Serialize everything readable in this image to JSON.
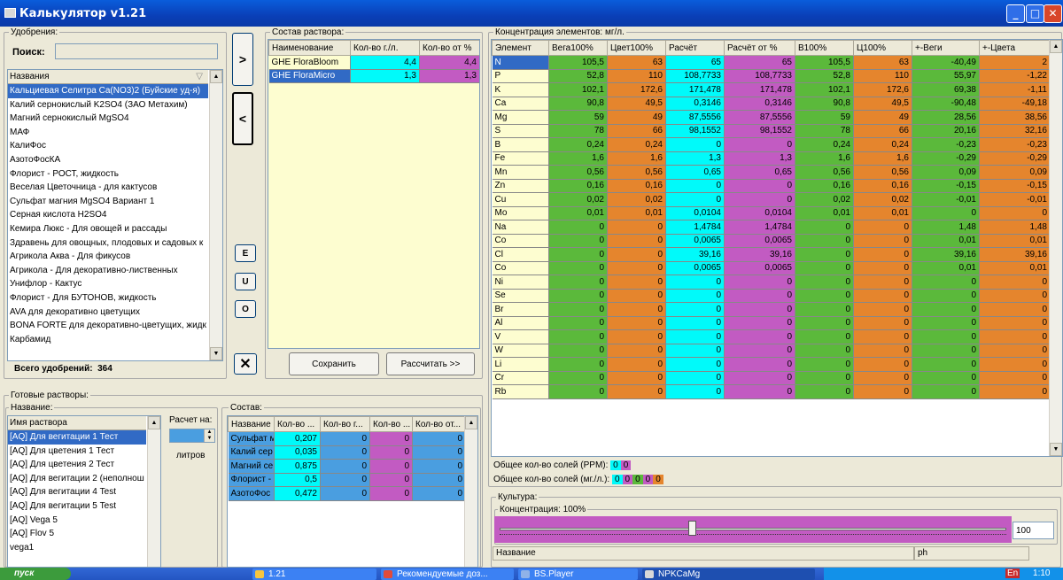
{
  "window": {
    "title": "Калькулятор v1.21",
    "btn_min": "_",
    "btn_max": "□",
    "btn_close": "✕"
  },
  "fert": {
    "group_title": "Удобрения:",
    "search_label": "Поиск:",
    "search_value": "",
    "col_header": "Названия",
    "total_label": "Всего удобрений:",
    "total_value": "364",
    "items": [
      "Кальциевая Селитра Ca(NO3)2 (Буйские уд-я)",
      "Калий  сернокислый  K2SO4 (ЗАО Метахим)",
      "Магний сернокислый MgSO4",
      "МАФ",
      "КалиФос",
      "АзотоФосКА",
      "Флорист - РОСТ, жидкость",
      "Веселая Цветочница - для кактусов",
      "Сульфат магния MgSO4 Вариант 1",
      "Серная кислота H2SO4",
      "Кемира Люкс - Для овощей и рассады",
      "Здравень для овощных, плодовых и садовых к",
      "Агрикола Аква - Для фикусов",
      "Агрикола - Для декоративно-лиственных",
      "Унифлор - Кактус",
      "Флорист - Для БУТОНОВ, жидкость",
      "AVA для декоративно цветущих",
      "BONA FORTE для декоративно-цветущих, жидк",
      "Карбамид"
    ]
  },
  "mid_buttons": {
    "add": ">",
    "remove": "<",
    "e": "E",
    "u": "U",
    "o": "O",
    "clear": "✕"
  },
  "sostav": {
    "group_title": "Состав раствора:",
    "headers": [
      "Наименование",
      "Кол-во г./л.",
      "Кол-во от %"
    ],
    "rows": [
      {
        "name": "GHE FloraBloom",
        "g": "4,4",
        "p": "4,4"
      },
      {
        "name": "GHE FloraMicro",
        "g": "1,3",
        "p": "1,3"
      }
    ],
    "save": "Сохранить",
    "calc": "Рассчитать >>"
  },
  "conc": {
    "group_title": "Концентрация элементов: мг/л.",
    "headers": [
      "Элемент",
      "Вега100%",
      "Цвет100%",
      "Расчёт",
      "Расчёт от %",
      "В100%",
      "Ц100%",
      "+-Веги",
      "+-Цвета"
    ],
    "rows": [
      [
        "N",
        "105,5",
        "63",
        "65",
        "65",
        "105,5",
        "63",
        "-40,49",
        "2"
      ],
      [
        "P",
        "52,8",
        "110",
        "108,7733",
        "108,7733",
        "52,8",
        "110",
        "55,97",
        "-1,22"
      ],
      [
        "K",
        "102,1",
        "172,6",
        "171,478",
        "171,478",
        "102,1",
        "172,6",
        "69,38",
        "-1,11"
      ],
      [
        "Ca",
        "90,8",
        "49,5",
        "0,3146",
        "0,3146",
        "90,8",
        "49,5",
        "-90,48",
        "-49,18"
      ],
      [
        "Mg",
        "59",
        "49",
        "87,5556",
        "87,5556",
        "59",
        "49",
        "28,56",
        "38,56"
      ],
      [
        "S",
        "78",
        "66",
        "98,1552",
        "98,1552",
        "78",
        "66",
        "20,16",
        "32,16"
      ],
      [
        "B",
        "0,24",
        "0,24",
        "0",
        "0",
        "0,24",
        "0,24",
        "-0,23",
        "-0,23"
      ],
      [
        "Fe",
        "1,6",
        "1,6",
        "1,3",
        "1,3",
        "1,6",
        "1,6",
        "-0,29",
        "-0,29"
      ],
      [
        "Mn",
        "0,56",
        "0,56",
        "0,65",
        "0,65",
        "0,56",
        "0,56",
        "0,09",
        "0,09"
      ],
      [
        "Zn",
        "0,16",
        "0,16",
        "0",
        "0",
        "0,16",
        "0,16",
        "-0,15",
        "-0,15"
      ],
      [
        "Cu",
        "0,02",
        "0,02",
        "0",
        "0",
        "0,02",
        "0,02",
        "-0,01",
        "-0,01"
      ],
      [
        "Mo",
        "0,01",
        "0,01",
        "0,0104",
        "0,0104",
        "0,01",
        "0,01",
        "0",
        "0"
      ],
      [
        "Na",
        "0",
        "0",
        "1,4784",
        "1,4784",
        "0",
        "0",
        "1,48",
        "1,48"
      ],
      [
        "Co",
        "0",
        "0",
        "0,0065",
        "0,0065",
        "0",
        "0",
        "0,01",
        "0,01"
      ],
      [
        "Cl",
        "0",
        "0",
        "39,16",
        "39,16",
        "0",
        "0",
        "39,16",
        "39,16"
      ],
      [
        "Co",
        "0",
        "0",
        "0,0065",
        "0,0065",
        "0",
        "0",
        "0,01",
        "0,01"
      ],
      [
        "Ni",
        "0",
        "0",
        "0",
        "0",
        "0",
        "0",
        "0",
        "0"
      ],
      [
        "Se",
        "0",
        "0",
        "0",
        "0",
        "0",
        "0",
        "0",
        "0"
      ],
      [
        "Br",
        "0",
        "0",
        "0",
        "0",
        "0",
        "0",
        "0",
        "0"
      ],
      [
        "Al",
        "0",
        "0",
        "0",
        "0",
        "0",
        "0",
        "0",
        "0"
      ],
      [
        "V",
        "0",
        "0",
        "0",
        "0",
        "0",
        "0",
        "0",
        "0"
      ],
      [
        "W",
        "0",
        "0",
        "0",
        "0",
        "0",
        "0",
        "0",
        "0"
      ],
      [
        "Li",
        "0",
        "0",
        "0",
        "0",
        "0",
        "0",
        "0",
        "0"
      ],
      [
        "Cr",
        "0",
        "0",
        "0",
        "0",
        "0",
        "0",
        "0",
        "0"
      ],
      [
        "Rb",
        "0",
        "0",
        "0",
        "0",
        "0",
        "0",
        "0",
        "0"
      ]
    ],
    "ppm_label": "Общее кол-во солей (PPM):",
    "ppm_v1": "0",
    "ppm_v2": "0",
    "mgl_label": "Общее кол-во солей (мг./л.):",
    "mgl_vals": [
      "0",
      "0",
      "0",
      "0",
      "0"
    ]
  },
  "ready": {
    "group_title": "Готовые растворы:",
    "name_group": "Название:",
    "col_header": "Имя раствора",
    "items": [
      "[AQ] Для вегитации 1 Тест",
      "[AQ] Для цветения 1 Тест",
      "[AQ] Для цветения 2 Тест",
      "[AQ] Для вегитации 2 (неполнош",
      "[AQ] Для вегитации 4 Test",
      "[AQ] Для вегитации 5 Test",
      "[AQ] Vega 5",
      "[AQ] Flov 5",
      "vega1"
    ],
    "calc_label": "Расчет на:",
    "liters": "литров",
    "calc_value": ""
  },
  "comp": {
    "group_title": "Состав:",
    "headers": [
      "Название",
      "Кол-во ...",
      "Кол-во г...",
      "Кол-во ...",
      "Кол-во от..."
    ],
    "rows": [
      [
        "Сульфат м",
        "0,207",
        "0",
        "0",
        "0"
      ],
      [
        "Калий  сер",
        "0,035",
        "0",
        "0",
        "0"
      ],
      [
        "Магний се",
        "0,875",
        "0",
        "0",
        "0"
      ],
      [
        "Флорист -",
        "0,5",
        "0",
        "0",
        "0"
      ],
      [
        "АзотоФос",
        "0,472",
        "0",
        "0",
        "0"
      ]
    ]
  },
  "culture": {
    "group_title": "Культура:",
    "conc_label": "Концентрация: 100%",
    "value": "100",
    "col_name": "Название",
    "col_ph": "ph",
    "slider_level": 0.38
  },
  "taskbar": {
    "start": "пуск",
    "items": [
      "1.21",
      "Рекомендуемые доз...",
      "BS.Player",
      "NPKCaMg"
    ],
    "lang": "En",
    "time": "1:10"
  }
}
